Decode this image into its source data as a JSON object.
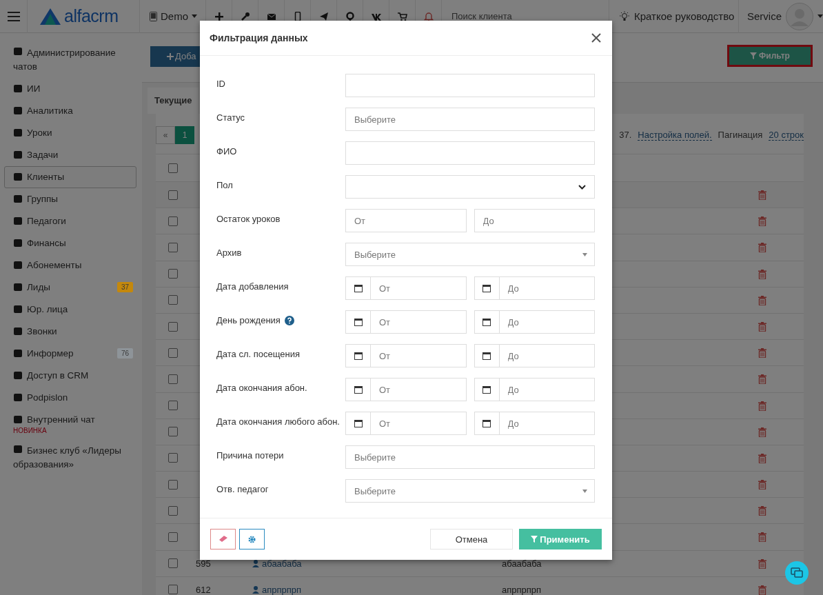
{
  "topbar": {
    "logo": "alfacrm",
    "branch": "Demo",
    "search": {
      "placeholder": "Поиск клиента"
    },
    "guide": "Краткое руководство",
    "user": "Service"
  },
  "sidebar": {
    "items": [
      {
        "label": "Администрирование чатов",
        "selected": false
      },
      {
        "label": "ИИ",
        "selected": false
      },
      {
        "label": "Аналитика",
        "selected": false
      },
      {
        "label": "Уроки",
        "selected": false
      },
      {
        "label": "Задачи",
        "selected": false
      },
      {
        "label": "Клиенты",
        "selected": true
      },
      {
        "label": "Группы",
        "selected": false
      },
      {
        "label": "Педагоги",
        "selected": false
      },
      {
        "label": "Финансы",
        "selected": false
      },
      {
        "label": "Абонементы",
        "selected": false
      },
      {
        "label": "Лиды",
        "selected": false,
        "badge": "37",
        "color": "#c4880c"
      },
      {
        "label": "Юр. лица",
        "selected": false
      },
      {
        "label": "Звонки",
        "selected": false
      },
      {
        "label": "Информер",
        "selected": false,
        "badge": "76",
        "color": "#8e9499"
      },
      {
        "label": "Доступ в CRM",
        "selected": false
      },
      {
        "label": "Podpislon",
        "selected": false
      },
      {
        "label": "Внутренний чат",
        "selected": false,
        "note": "НОВИНКА"
      },
      {
        "label": "Бизнес клуб «Лидеры образования»",
        "selected": false
      }
    ]
  },
  "toolbar": {
    "add_button": "Доба",
    "filter_button": {
      "label": "Фильтр",
      "highlighted": true
    }
  },
  "tabs": [
    {
      "label": "Текущие",
      "selected": true
    }
  ],
  "pagination": {
    "prev": "«",
    "pages": [
      {
        "label": "1",
        "selected": true
      }
    ],
    "count_tail": "37.",
    "fields_link": "Настройка полей.",
    "per_page_label": "Пагинация",
    "per_page": "20 строк"
  },
  "table": {
    "header_checked": false,
    "rows": [
      {
        "checked": false
      },
      {
        "checked": false
      },
      {
        "checked": false
      },
      {
        "checked": false
      },
      {
        "checked": false
      },
      {
        "checked": false
      },
      {
        "checked": false
      },
      {
        "checked": false
      },
      {
        "checked": false
      },
      {
        "checked": false
      },
      {
        "checked": false
      },
      {
        "checked": false
      },
      {
        "checked": false
      },
      {
        "checked": false
      },
      {
        "column_1": "595",
        "name": "абаабаба",
        "column_3": "абаабаба",
        "checked": false
      },
      {
        "column_1": "612",
        "name": "апрпрпрп",
        "column_3": "апрпрпрп",
        "checked": false
      }
    ]
  },
  "filter_modal": {
    "title": "Фильтрация данных",
    "fields": [
      {
        "label": "ID",
        "kind": "text"
      },
      {
        "label": "Статус",
        "kind": "select",
        "placeholder": "Выберите"
      },
      {
        "label": "ФИО",
        "kind": "text"
      },
      {
        "label": "Пол",
        "kind": "native-select"
      },
      {
        "label": "Остаток уроков",
        "kind": "range",
        "from": {
          "placeholder": "От"
        },
        "to": {
          "placeholder": "До"
        }
      },
      {
        "label": "Архив",
        "kind": "dropdown",
        "placeholder": "Выберите"
      },
      {
        "label": "Дата добавления",
        "kind": "date-range",
        "from": {
          "placeholder": "От"
        },
        "to": {
          "placeholder": "До"
        }
      },
      {
        "label": "День рождения",
        "kind": "date-range",
        "from": {
          "placeholder": "От"
        },
        "to": {
          "placeholder": "До"
        },
        "help": true
      },
      {
        "label": "Дата сл. посещения",
        "kind": "date-range",
        "from": {
          "placeholder": "От"
        },
        "to": {
          "placeholder": "До"
        }
      },
      {
        "label": "Дата окончания абон.",
        "kind": "date-range",
        "from": {
          "placeholder": "От"
        },
        "to": {
          "placeholder": "До"
        }
      },
      {
        "label": "Дата окончания любого абон.",
        "kind": "date-range",
        "from": {
          "placeholder": "От"
        },
        "to": {
          "placeholder": "До"
        }
      },
      {
        "label": "Причина потери",
        "kind": "select",
        "placeholder": "Выберите"
      },
      {
        "label": "Отв. педагог",
        "kind": "dropdown",
        "placeholder": "Выберите"
      }
    ],
    "cancel": "Отмена",
    "apply": "Применить"
  }
}
